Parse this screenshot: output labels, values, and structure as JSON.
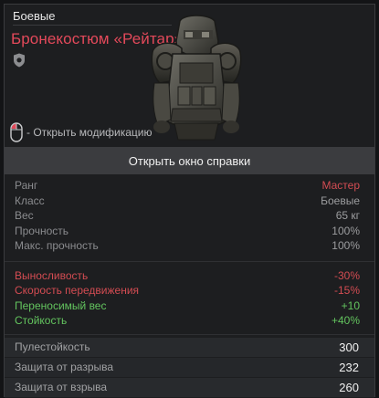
{
  "item": {
    "category": "Боевые",
    "name": "Бронекостюм «Рейтар»",
    "icon": "shield-icon",
    "mod_hint": "- Открыть модификацию"
  },
  "help_button": "Открыть окно справки",
  "info": [
    {
      "label": "Ранг",
      "value": "Мастер"
    },
    {
      "label": "Класс",
      "value": "Боевые"
    },
    {
      "label": "Вес",
      "value": "65 кг"
    },
    {
      "label": "Прочность",
      "value": "100%"
    },
    {
      "label": "Макс. прочность",
      "value": "100%"
    }
  ],
  "modifiers": [
    {
      "label": "Выносливость",
      "value": "-30%"
    },
    {
      "label": "Скорость передвижения",
      "value": "-15%"
    },
    {
      "label": "Переносимый вес",
      "value": "+10"
    },
    {
      "label": "Стойкость",
      "value": "+40%"
    }
  ],
  "protection": [
    {
      "label": "Пулестойкость",
      "value": "300"
    },
    {
      "label": "Защита от разрыва",
      "value": "232"
    },
    {
      "label": "Защита от взрыва",
      "value": "260"
    }
  ],
  "colors": {
    "rank_master": "#e3495a",
    "negative": "#d34c52",
    "positive": "#63c45e"
  }
}
